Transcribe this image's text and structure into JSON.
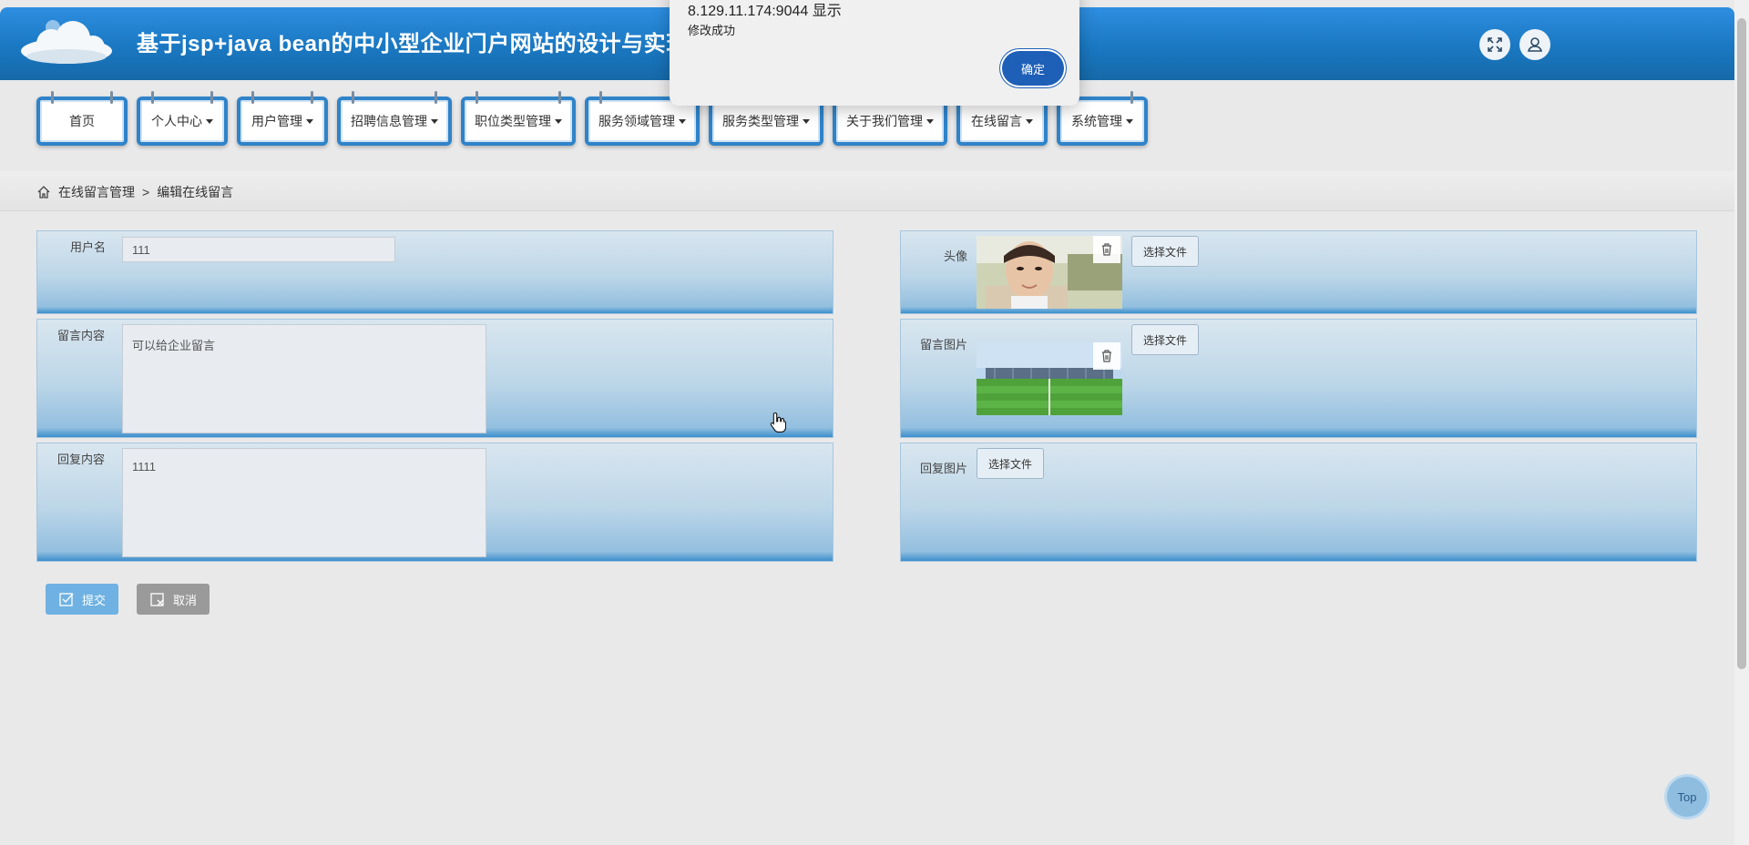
{
  "header": {
    "title": "基于jsp+java bean的中小型企业门户网站的设计与实现",
    "fullscreen_icon": "expand-icon",
    "user_icon": "user-icon"
  },
  "nav": {
    "items": [
      {
        "label": "首页",
        "dropdown": false
      },
      {
        "label": "个人中心",
        "dropdown": true
      },
      {
        "label": "用户管理",
        "dropdown": true
      },
      {
        "label": "招聘信息管理",
        "dropdown": true
      },
      {
        "label": "职位类型管理",
        "dropdown": true
      },
      {
        "label": "服务领域管理",
        "dropdown": true
      },
      {
        "label": "服务类型管理",
        "dropdown": true
      },
      {
        "label": "关于我们管理",
        "dropdown": true
      },
      {
        "label": "在线留言",
        "dropdown": true
      },
      {
        "label": "系统管理",
        "dropdown": true
      }
    ]
  },
  "breadcrumb": {
    "home_icon": "home-icon",
    "parent": "在线留言管理",
    "separator": ">",
    "current": "编辑在线留言"
  },
  "form": {
    "username_label": "用户名",
    "username_value": "111",
    "avatar_label": "头像",
    "content_label": "留言内容",
    "content_value": "可以给企业留言",
    "image_label": "留言图片",
    "reply_label": "回复内容",
    "reply_value": "1111",
    "reply_image_label": "回复图片",
    "choose_file": "选择文件"
  },
  "actions": {
    "submit": "提交",
    "cancel": "取消"
  },
  "dialog": {
    "origin": "8.129.11.174:9044 显示",
    "message": "修改成功",
    "ok": "确定"
  },
  "top_button": "Top",
  "colors": {
    "header": "#1a78c2",
    "nav_border": "#2f83c9",
    "submit": "#6fb1e2",
    "cancel": "#9a9a9a",
    "dialog_ok": "#1e5fb8"
  }
}
